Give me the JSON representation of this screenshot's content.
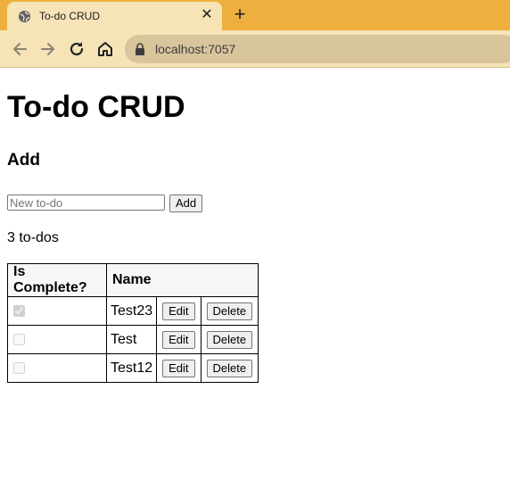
{
  "browser": {
    "tab_title": "To-do CRUD",
    "close_glyph": "✕",
    "new_tab_glyph": "+",
    "url": "localhost:7057"
  },
  "page": {
    "title": "To-do CRUD",
    "add_heading": "Add",
    "new_todo_placeholder": "New to-do",
    "new_todo_value": "",
    "add_button": "Add",
    "counter": "3 to-dos"
  },
  "table": {
    "headers": [
      "Is Complete?",
      "Name",
      "",
      ""
    ],
    "rows": [
      {
        "complete": true,
        "name": "Test23",
        "edit": "Edit",
        "delete": "Delete"
      },
      {
        "complete": false,
        "name": "Test",
        "edit": "Edit",
        "delete": "Delete"
      },
      {
        "complete": false,
        "name": "Test12",
        "edit": "Edit",
        "delete": "Delete"
      }
    ]
  },
  "colors": {
    "tabstrip": "#eeaf3f",
    "toolbar": "#f6e3b6",
    "omnibox": "#d9c59c"
  }
}
